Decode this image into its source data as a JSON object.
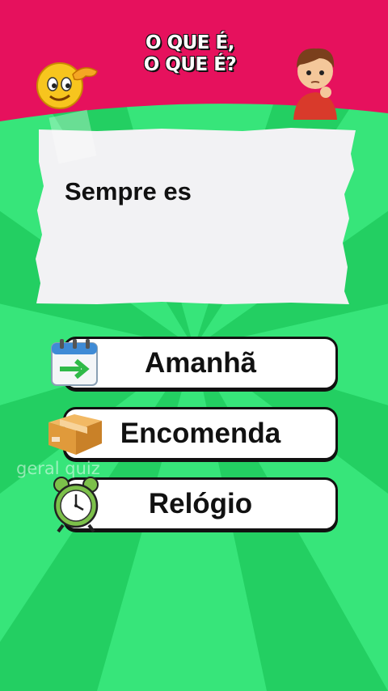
{
  "header": {
    "title_line1": "O QUE É,",
    "title_line2": "O QUE É?"
  },
  "question": {
    "text": "Sempre es"
  },
  "options": [
    {
      "label": "Amanhã",
      "icon": "calendar-arrow-icon"
    },
    {
      "label": "Encomenda",
      "icon": "package-box-icon"
    },
    {
      "label": "Relógio",
      "icon": "alarm-clock-icon"
    }
  ],
  "watermark": "geral quiz",
  "colors": {
    "header": "#e6115d",
    "background_light": "#3aec80",
    "background_dark": "#20c95c",
    "paper": "#f2f2f4"
  }
}
